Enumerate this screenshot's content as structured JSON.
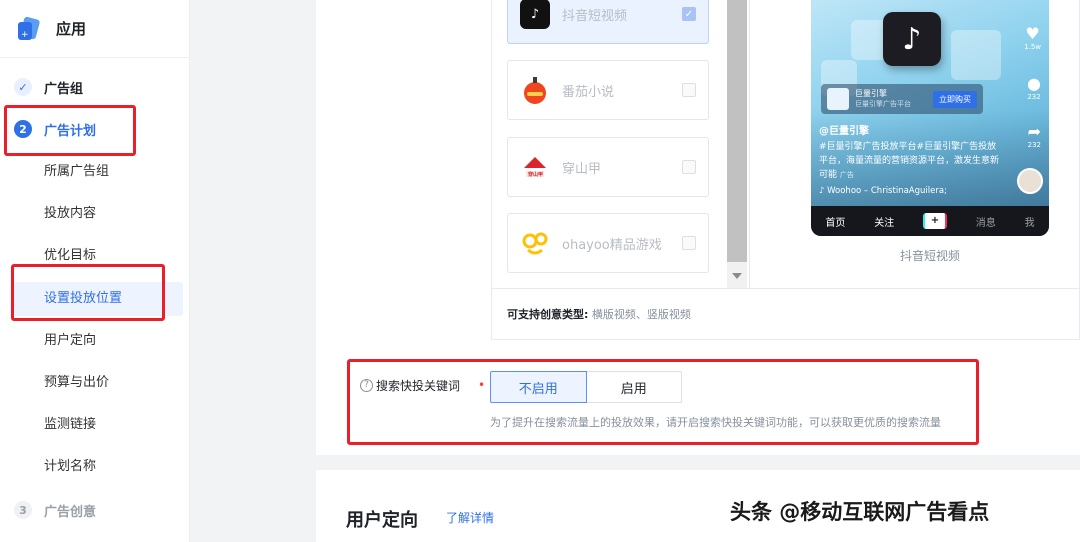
{
  "app": {
    "title": "应用"
  },
  "steps": [
    {
      "index": "✓",
      "label": "广告组"
    },
    {
      "index": "2",
      "label": "广告计划"
    },
    {
      "index": "3",
      "label": "广告创意"
    }
  ],
  "substeps": [
    "所属广告组",
    "投放内容",
    "优化目标",
    "设置投放位置",
    "用户定向",
    "预算与出价",
    "监测链接",
    "计划名称"
  ],
  "placements": [
    {
      "name": "抖音短视频",
      "checked": true
    },
    {
      "name": "番茄小说",
      "checked": false
    },
    {
      "name": "穿山甲",
      "checked": false
    },
    {
      "name": "ohayoo精品游戏",
      "checked": false
    }
  ],
  "creative_types": {
    "label": "可支持创意类型:",
    "value": "横版视频、竖版视频"
  },
  "preview": {
    "caption": "抖音短视频",
    "ad_name": "巨量引擎",
    "ad_sub": "巨量引擎广告平台",
    "ad_button": "立即购买",
    "account": "@巨量引擎",
    "description": "#巨量引擎广告投放平台#巨量引擎广告投放平台，海量流量的营销资源平台，激发生意新可能",
    "ad_tag": "广告",
    "music": "♪ Woohoo – ChristinaAguilera;",
    "counts": [
      "1.5w",
      "232",
      "232"
    ],
    "nav": [
      "首页",
      "关注",
      "+",
      "消息",
      "我"
    ]
  },
  "search_keyword": {
    "label": "搜索快投关键词",
    "required": "•",
    "options": [
      "不启用",
      "启用"
    ],
    "selected": "不启用",
    "hint": "为了提升在搜索流量上的投放效果，请开启搜索快投关键词功能，可以获取更优质的搜索流量"
  },
  "targeting": {
    "title": "用户定向",
    "link": "了解详情"
  },
  "watermark": "头条 @移动互联网广告看点",
  "colors": {
    "primary": "#2f6fe8",
    "highlight_border": "#ea1f2a"
  }
}
